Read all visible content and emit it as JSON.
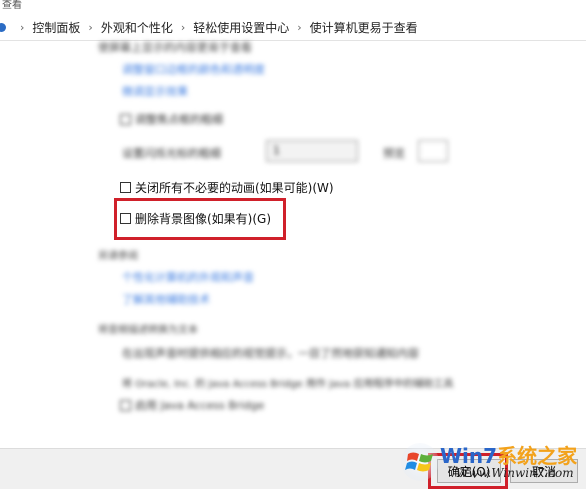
{
  "window": {
    "title_fragment": "查看"
  },
  "breadcrumb": {
    "items": [
      "控制面板",
      "外观和个性化",
      "轻松使用设置中心",
      "使计算机更易于查看"
    ]
  },
  "blurred": {
    "heading_top": "使屏幕上显示的内容更易于查看",
    "link_1": "调整窗口边框的颜色和透明度",
    "link_2": "微调显示效果",
    "option_1": "调整焦点框的粗细",
    "label_focus": "设置闪烁光标的粗细",
    "label_focus_value": "1",
    "label_preview": "预览",
    "section_2_heading": "另请参阅",
    "link_3": "个性化计算机的外观和声音",
    "link_4": "了解其他辅助技术",
    "section_3_heading": "将音频描述转换为文本",
    "text_1": "在出现声音时提供相应的视觉提示，一目了然地获知通知内容",
    "text_2": "将 Oracle, Inc. 的 Java Access Bridge 用作 Java 应用程序中的辅助工具",
    "option_2": "启用 Java Access Bridge"
  },
  "options": {
    "disable_animations": {
      "label": "关闭所有不必要的动画(如果可能)(W)",
      "checked": false
    },
    "remove_background": {
      "label": "删除背景图像(如果有)(G)",
      "checked": false
    }
  },
  "buttons": {
    "ok": "确定(O)",
    "cancel": "取消",
    "apply": "应用(A)"
  },
  "watermark": {
    "brand_main": "Win7",
    "brand_rest": "系统之家",
    "url": "Www.Winwin7.com"
  },
  "colors": {
    "highlight_red": "#d0202a",
    "link_blue": "#3b7be0",
    "brand_blue": "#2a66c9",
    "brand_orange": "#f3a21b"
  },
  "icons": [
    "control-panel-icon",
    "chevron-right-icon",
    "windows-logo-icon"
  ]
}
